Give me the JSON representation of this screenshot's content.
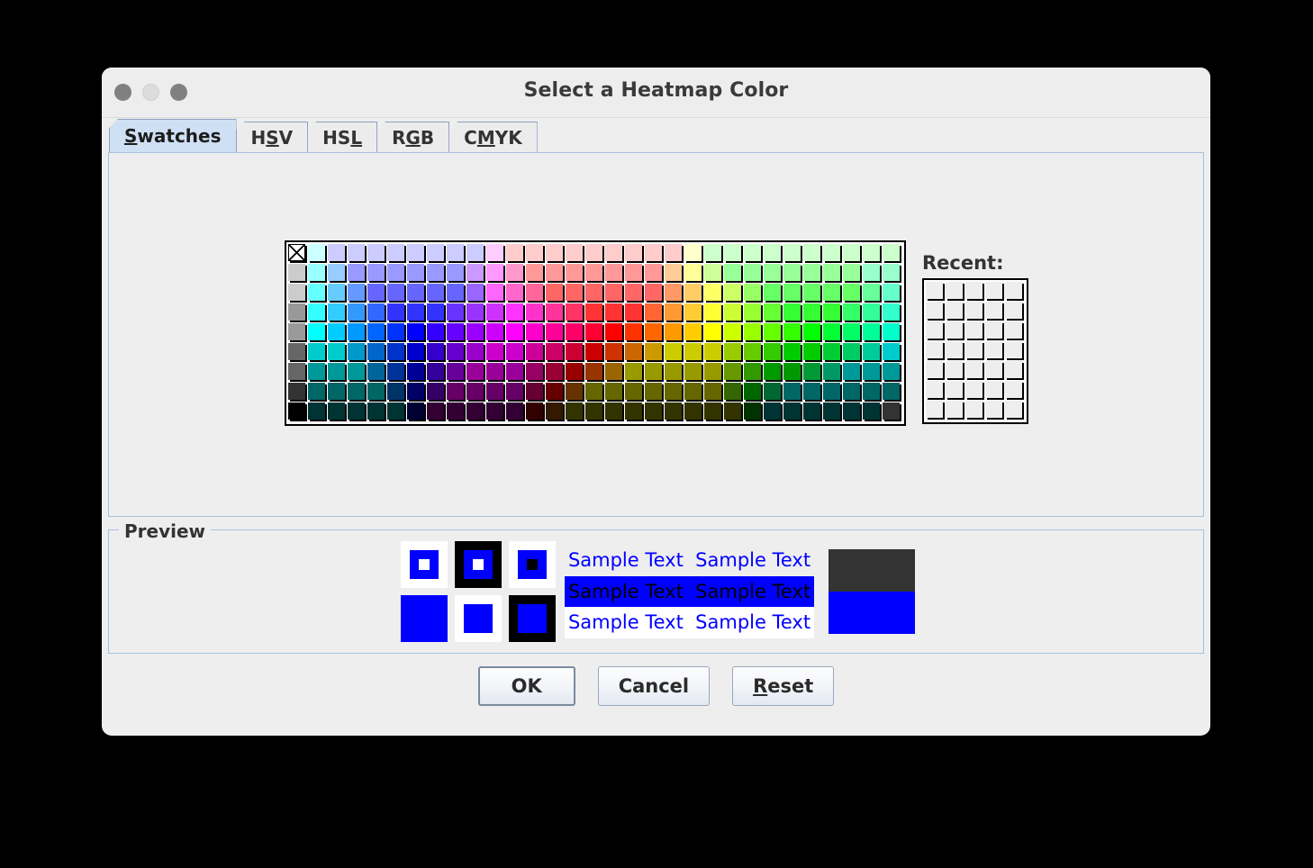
{
  "window": {
    "title": "Select a Heatmap Color",
    "traffic_lights": [
      "close-button",
      "minimize-button",
      "zoom-button"
    ]
  },
  "tabs": [
    {
      "label": "Swatches",
      "mnemonic_index": 0,
      "selected": true
    },
    {
      "label": "HSV",
      "mnemonic_index": 1,
      "selected": false
    },
    {
      "label": "HSL",
      "mnemonic_index": 2,
      "selected": false
    },
    {
      "label": "RGB",
      "mnemonic_index": 1,
      "selected": false
    },
    {
      "label": "CMYK",
      "mnemonic_index": 1,
      "selected": false
    }
  ],
  "swatches": {
    "columns": 31,
    "rows": 9,
    "first_cell": "no-color-x",
    "colors": [
      "#FFFFFF",
      "#CCFFFF",
      "#CCCCFF",
      "#CCCCFF",
      "#CCCCFF",
      "#CCCCFF",
      "#CCCCFF",
      "#CCCCFF",
      "#CCCCFF",
      "#CCCCFF",
      "#FFCCFF",
      "#FFCCCC",
      "#FFCCCC",
      "#FFCCCC",
      "#FFCCCC",
      "#FFCCCC",
      "#FFCCCC",
      "#FFCCCC",
      "#FFCCCC",
      "#FFCCCC",
      "#FFFFCC",
      "#CCFFCC",
      "#CCFFCC",
      "#CCFFCC",
      "#CCFFCC",
      "#CCFFCC",
      "#CCFFCC",
      "#CCFFCC",
      "#CCFFCC",
      "#CCFFCC",
      "#CCFFCC",
      "#CCCCCC",
      "#99FFFF",
      "#99CCFF",
      "#9999FF",
      "#9999FF",
      "#9999FF",
      "#9999FF",
      "#9999FF",
      "#9999FF",
      "#CC99FF",
      "#FF99FF",
      "#FF99CC",
      "#FF9999",
      "#FF9999",
      "#FF9999",
      "#FF9999",
      "#FF9999",
      "#FF9999",
      "#FF9999",
      "#FFCC99",
      "#FFFF99",
      "#CCFF99",
      "#99FF99",
      "#99FF99",
      "#99FF99",
      "#99FF99",
      "#99FF99",
      "#99FF99",
      "#99FF99",
      "#99FFCC",
      "#99FFCC",
      "#CCCCCC",
      "#66FFFF",
      "#66CCFF",
      "#6699FF",
      "#6666FF",
      "#6666FF",
      "#6666FF",
      "#6666FF",
      "#6666FF",
      "#9966FF",
      "#FF66FF",
      "#FF66CC",
      "#FF6699",
      "#FF6666",
      "#FF6666",
      "#FF6666",
      "#FF6666",
      "#FF6666",
      "#FF6666",
      "#FF9966",
      "#FFCC66",
      "#FFFF66",
      "#CCFF66",
      "#99FF66",
      "#66FF66",
      "#66FF66",
      "#66FF66",
      "#66FF66",
      "#66FF66",
      "#66FF99",
      "#66FFCC",
      "#999999",
      "#33FFFF",
      "#33CCFF",
      "#3399FF",
      "#3366FF",
      "#3333FF",
      "#3333FF",
      "#3333FF",
      "#6633FF",
      "#9933FF",
      "#CC33FF",
      "#FF33FF",
      "#FF33CC",
      "#FF3399",
      "#FF3366",
      "#FF3333",
      "#FF3333",
      "#FF3333",
      "#FF6633",
      "#FF9933",
      "#FFCC33",
      "#FFFF33",
      "#CCFF33",
      "#99FF33",
      "#66FF33",
      "#33FF33",
      "#33FF33",
      "#33FF33",
      "#33FF66",
      "#33FF99",
      "#33FFCC",
      "#999999",
      "#00FFFF",
      "#00CCFF",
      "#0099FF",
      "#0066FF",
      "#0033FF",
      "#0000FF",
      "#3300FF",
      "#6600FF",
      "#9900FF",
      "#CC00FF",
      "#FF00FF",
      "#FF00CC",
      "#FF0099",
      "#FF0066",
      "#FF0033",
      "#FF0000",
      "#FF3300",
      "#FF6600",
      "#FF9900",
      "#FFCC00",
      "#FFFF00",
      "#CCFF00",
      "#99FF00",
      "#66FF00",
      "#33FF00",
      "#00FF00",
      "#00FF33",
      "#00FF66",
      "#00FF99",
      "#00FFCC",
      "#666666",
      "#00CCCC",
      "#00CCCC",
      "#0099CC",
      "#0066CC",
      "#0033CC",
      "#0000CC",
      "#3300CC",
      "#6600CC",
      "#9900CC",
      "#CC00CC",
      "#CC00CC",
      "#CC0099",
      "#CC0066",
      "#CC0033",
      "#CC0000",
      "#CC3300",
      "#CC6600",
      "#CC9900",
      "#CCCC00",
      "#CCCC00",
      "#CCCC00",
      "#99CC00",
      "#66CC00",
      "#33CC00",
      "#00CC00",
      "#00CC00",
      "#00CC33",
      "#00CC66",
      "#00CC99",
      "#00CCCC",
      "#666666",
      "#009999",
      "#009999",
      "#009999",
      "#006699",
      "#003399",
      "#000099",
      "#330099",
      "#660099",
      "#990099",
      "#990099",
      "#990099",
      "#990066",
      "#990033",
      "#990000",
      "#993300",
      "#996600",
      "#999900",
      "#999900",
      "#999900",
      "#999900",
      "#999900",
      "#669900",
      "#339900",
      "#009900",
      "#009900",
      "#009933",
      "#009966",
      "#009999",
      "#009999",
      "#009999",
      "#333333",
      "#006666",
      "#006666",
      "#006666",
      "#006666",
      "#003366",
      "#000066",
      "#330066",
      "#660066",
      "#660066",
      "#660066",
      "#660066",
      "#660033",
      "#660000",
      "#663300",
      "#666600",
      "#666600",
      "#666600",
      "#666600",
      "#666600",
      "#666600",
      "#666600",
      "#336600",
      "#006600",
      "#006633",
      "#006666",
      "#006666",
      "#006666",
      "#006666",
      "#006666",
      "#006666",
      "#000000",
      "#003333",
      "#003333",
      "#003333",
      "#003333",
      "#003333",
      "#000033",
      "#330033",
      "#330033",
      "#330033",
      "#330033",
      "#330033",
      "#330000",
      "#331900",
      "#333300",
      "#333300",
      "#333300",
      "#333300",
      "#333300",
      "#333300",
      "#333300",
      "#333300",
      "#333300",
      "#003300",
      "#003333",
      "#003333",
      "#003333",
      "#003333",
      "#003333",
      "#003333",
      "#333333"
    ]
  },
  "recent": {
    "label": "Recent:",
    "columns": 5,
    "rows": 7,
    "empty_color": "#EEEEEE"
  },
  "preview": {
    "title": "Preview",
    "selected_color": "#0000FF",
    "swatch_cells": [
      {
        "name": "preview-swatch-white-blue-white",
        "outer": "#FFFFFF",
        "mid": "#0000FF",
        "inner": "#FFFFFF"
      },
      {
        "name": "preview-swatch-black-blue-white",
        "outer": "#000000",
        "mid": "#0000FF",
        "inner": "#FFFFFF"
      },
      {
        "name": "preview-swatch-white-blue-black",
        "outer": "#FFFFFF",
        "mid": "#0000FF",
        "inner": "#000000"
      },
      {
        "name": "preview-swatch-solid-blue",
        "outer": "#0000FF",
        "mid": "#0000FF",
        "inner": "#0000FF"
      },
      {
        "name": "preview-swatch-white-blue",
        "outer": "#FFFFFF",
        "mid": "#0000FF",
        "inner": "#0000FF"
      },
      {
        "name": "preview-swatch-black-blue",
        "outer": "#000000",
        "mid": "#0000FF",
        "inner": "#0000FF"
      }
    ],
    "sample_lines": [
      {
        "text": "Sample Text  Sample Text",
        "fg": "#0000FF",
        "bg": "#EEEEEE"
      },
      {
        "text": "Sample Text  Sample Text",
        "fg": "#000000",
        "bg": "#0000FF"
      },
      {
        "text": "Sample Text  Sample Text",
        "fg": "#0000FF",
        "bg": "#FFFFFF"
      }
    ],
    "two_tone": {
      "top": "#333333",
      "bottom": "#0000FF"
    }
  },
  "buttons": [
    {
      "label": "OK",
      "mnemonic_index": -1,
      "focused": true
    },
    {
      "label": "Cancel",
      "mnemonic_index": -1,
      "focused": false
    },
    {
      "label": "Reset",
      "mnemonic_index": 0,
      "focused": false
    }
  ]
}
